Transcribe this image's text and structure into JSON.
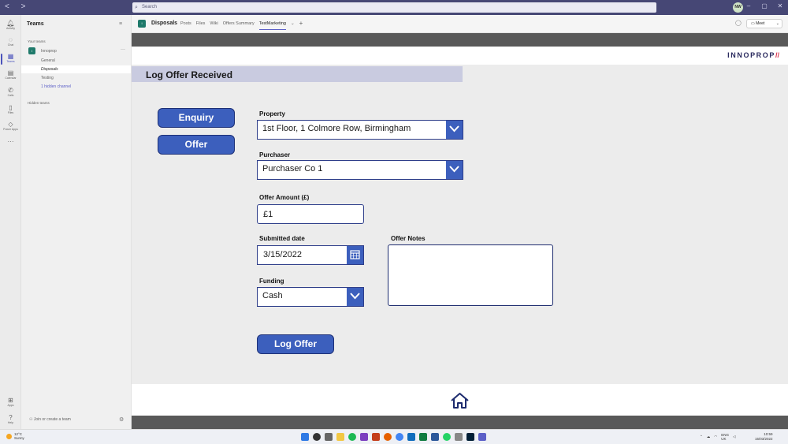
{
  "window": {
    "search_placeholder": "Search",
    "avatar_initials": "NW"
  },
  "rail": [
    {
      "label": "Activity",
      "icon": "bell-icon"
    },
    {
      "label": "Chat",
      "icon": "chat-icon"
    },
    {
      "label": "Teams",
      "icon": "teams-icon"
    },
    {
      "label": "Calendar",
      "icon": "calendar-icon"
    },
    {
      "label": "Calls",
      "icon": "phone-icon"
    },
    {
      "label": "Files",
      "icon": "file-icon"
    },
    {
      "label": "Power Apps",
      "icon": "power-apps-icon"
    },
    {
      "label": "Apps",
      "icon": "apps-icon"
    },
    {
      "label": "Help",
      "icon": "help-icon"
    }
  ],
  "teams_pane": {
    "title": "Teams",
    "your_teams": "Your teams",
    "team_name": "Innoprop",
    "team_badge": "I",
    "channels": [
      "General",
      "Disposals",
      "Testing"
    ],
    "hidden_channel": "1 hidden channel",
    "hidden_teams": "Hidden teams",
    "join_label": "Join or create a team"
  },
  "channel_header": {
    "name": "Disposals",
    "tabs": [
      "Posts",
      "Files",
      "Wiki",
      "Offers Summary",
      "TestMarketing"
    ],
    "meet_label": "Meet"
  },
  "app": {
    "brand": "INNOPROP",
    "brand_slash": "//",
    "page_title": "Log Offer Received",
    "buttons": {
      "enquiry": "Enquiry",
      "offer": "Offer",
      "log_offer": "Log Offer"
    },
    "form": {
      "property_label": "Property",
      "property_value": "1st Floor, 1 Colmore Row, Birmingham",
      "purchaser_label": "Purchaser",
      "purchaser_value": "Purchaser Co 1",
      "offer_amount_label": "Offer Amount (£)",
      "offer_amount_value": "£1",
      "submitted_date_label": "Submitted date",
      "submitted_date_value": "3/15/2022",
      "funding_label": "Funding",
      "funding_value": "Cash",
      "offer_notes_label": "Offer Notes",
      "offer_notes_value": ""
    },
    "colors": {
      "accent": "#3c5fbd",
      "border": "#2e3e8a",
      "header_band": "#c9cbe0",
      "dark_bar": "#595959",
      "teams_purple": "#464775"
    }
  },
  "taskbar": {
    "weather_temp": "12°C",
    "weather_desc": "Sunny",
    "lang_line1": "ENG",
    "lang_line2": "UK",
    "time": "10:59",
    "date": "15/03/2022"
  }
}
